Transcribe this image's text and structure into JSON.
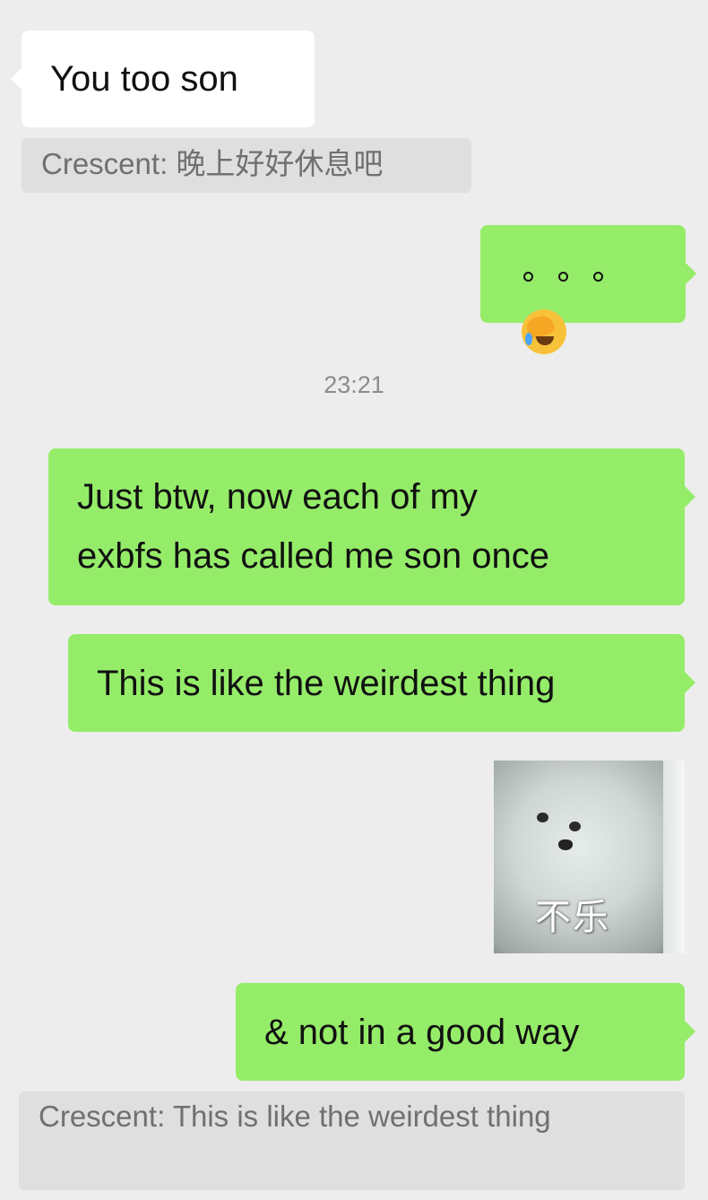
{
  "messages": {
    "m1": {
      "text": "You too son"
    },
    "q1": {
      "sender": "Crescent",
      "separator": ":",
      "text": "晚上好好休息吧"
    },
    "m2": {
      "emoji": "face-palm-crying-icon"
    },
    "time1": "23:21",
    "m3": {
      "line1": "Just btw, now each of my",
      "line2": "exbfs has called me son once"
    },
    "m4": {
      "text": "This is like the weirdest thing"
    },
    "sticker": {
      "caption": "不乐"
    },
    "m5": {
      "text": "& not in a good way"
    },
    "q2": {
      "sender": "Crescent",
      "separator": ":",
      "text": "This is like the weirdest thing"
    }
  },
  "colors": {
    "background": "#ededed",
    "incoming_bubble": "#ffffff",
    "outgoing_bubble": "#95ec69",
    "quote_bg": "#dfdfdf",
    "quote_text": "#707070",
    "time_text": "#8c8c8c"
  }
}
